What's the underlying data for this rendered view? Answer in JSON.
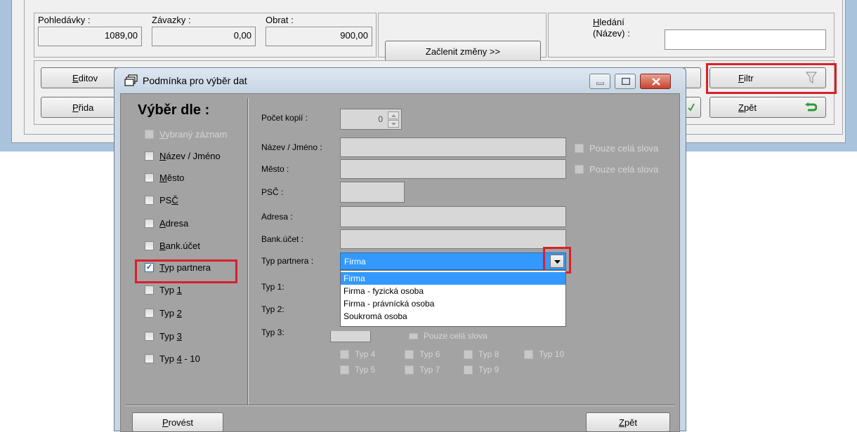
{
  "summary": {
    "pohledavky_label": "Pohledávky :",
    "pohledavky_value": "1089,00",
    "zavazky_label": "Závazky :",
    "zavazky_value": "0,00",
    "obrat_label": "Obrat :",
    "obrat_value": "900,00"
  },
  "toolbar": {
    "zaclenit_label": "Začlenit změny >>",
    "edit_label_visible": "Editov",
    "edit_accesskey": "E",
    "edit_rest": "ditov",
    "add_accesskey": "P",
    "add_rest": "řida",
    "filtr_accesskey": "F",
    "filtr_rest": "iltr",
    "zpet_accesskey": "Z",
    "zpet_rest": "pět"
  },
  "search": {
    "label_line1_accesskey": "H",
    "label_line1_rest": "ledání",
    "label_line2": "(Název) :",
    "value": ""
  },
  "dialog": {
    "title": "Podmínka pro výběr dat",
    "left_heading": "Výběr dle :",
    "checkboxes": [
      {
        "pre": "",
        "key": "V",
        "post": "ybraný záznam",
        "checked": false,
        "disabled": true
      },
      {
        "pre": "",
        "key": "N",
        "post": "ázev / Jméno",
        "checked": false,
        "disabled": false
      },
      {
        "pre": "",
        "key": "M",
        "post": "ěsto",
        "checked": false,
        "disabled": false
      },
      {
        "pre": "PS",
        "key": "Č",
        "post": "",
        "checked": false,
        "disabled": false
      },
      {
        "pre": "",
        "key": "A",
        "post": "dresa",
        "checked": false,
        "disabled": false
      },
      {
        "pre": "",
        "key": "B",
        "post": "ank.účet",
        "checked": false,
        "disabled": false
      },
      {
        "pre": "",
        "key": "T",
        "post": "yp partnera",
        "checked": true,
        "disabled": false
      },
      {
        "pre": "Typ ",
        "key": "1",
        "post": "",
        "checked": false,
        "disabled": false
      },
      {
        "pre": "Typ ",
        "key": "2",
        "post": "",
        "checked": false,
        "disabled": false
      },
      {
        "pre": "Typ ",
        "key": "3",
        "post": "",
        "checked": false,
        "disabled": false
      },
      {
        "pre": "Typ ",
        "key": "4",
        "post": " - 10",
        "checked": false,
        "disabled": false
      }
    ],
    "pocet_kopii_label": "Počet kopií :",
    "pocet_kopii_value": "0",
    "nazev_label": "Název / Jméno :",
    "mesto_label": "Město :",
    "psc_label": "PSČ :",
    "adresa_label": "Adresa :",
    "bank_label": "Bank.účet :",
    "typ_partnera_label": "Typ partnera :",
    "typ_partnera_value": "Firma",
    "typ1_label": "Typ 1:",
    "typ2_label": "Typ 2:",
    "typ3_label": "Typ 3:",
    "pouze_cela_slova": "Pouze celá slova",
    "dropdown_options": [
      "Firma",
      "Firma - fyzická osoba",
      "Firma - právnícká osoba",
      "Soukromá osoba"
    ],
    "hidden_text": "Pouze celá slova",
    "typ_grid": [
      "Typ 4",
      "Typ 6",
      "Typ 8",
      "Typ 10",
      "Typ 5",
      "Typ 7",
      "Typ 9"
    ],
    "provest_accesskey": "P",
    "provest_rest": "rovést",
    "zpet_accesskey": "Z",
    "zpet_rest": "pět"
  }
}
